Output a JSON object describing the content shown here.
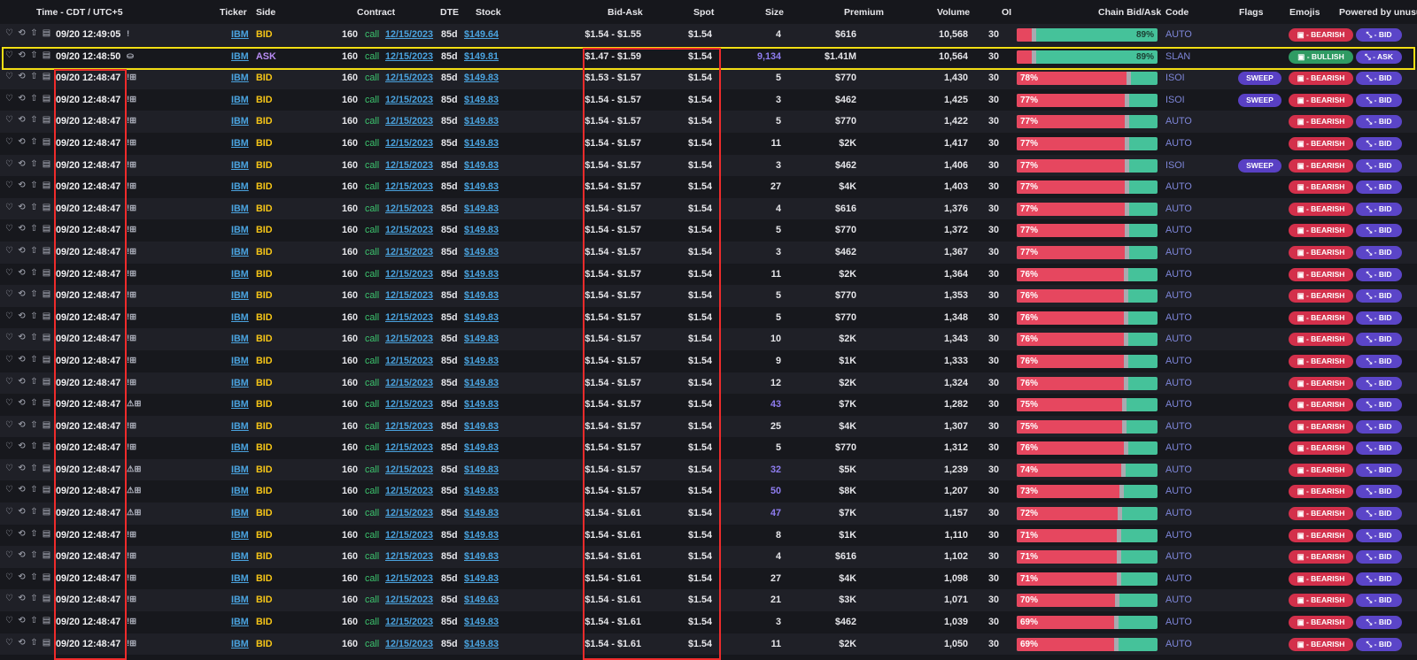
{
  "header": {
    "time": "Time - CDT / UTC+5",
    "ticker": "Ticker",
    "side": "Side",
    "contract": "Contract",
    "dte": "DTE",
    "stock": "Stock",
    "bid_ask": "Bid-Ask",
    "spot": "Spot",
    "size": "Size",
    "premium": "Premium",
    "volume": "Volume",
    "oi": "OI",
    "chain_bid_ask": "Chain Bid/Ask",
    "code": "Code",
    "flags": "Flags",
    "emojis": "Emojis",
    "powered_by": "Powered by unusu"
  },
  "colors": {
    "bid_side": "#f5c518",
    "ask_side": "#b98cf5",
    "link": "#4aa3df",
    "bar_bid": "#e6475f",
    "bar_ask": "#45c29a",
    "highlight_red": "#ef2b2b",
    "highlight_yellow": "#f3de14"
  },
  "rows": [
    {
      "time": "09/20 12:49:05",
      "flag_icon": "!",
      "ticker": "IBM",
      "side": "BID",
      "strike": "160",
      "type": "call",
      "expiry": "12/15/2023",
      "dte": "85d",
      "stock": "$149.64",
      "bid_ask": "$1.54 - $1.55",
      "spot": "$1.54",
      "size": "4",
      "premium": "$616",
      "volume": "10,568",
      "oi": "30",
      "chain_pct": "89%",
      "chain_red": 0.11,
      "code": "AUTO",
      "flag": "",
      "emoji": "- BEARISH",
      "side_pill": "- BID"
    },
    {
      "time": "09/20 12:48:50",
      "flag_icon": "⛀",
      "ticker": "IBM",
      "side": "ASK",
      "strike": "160",
      "type": "call",
      "expiry": "12/15/2023",
      "dte": "85d",
      "stock": "$149.81",
      "bid_ask": "$1.47 - $1.59",
      "spot": "$1.54",
      "size": "9,134",
      "premium": "$1.41M",
      "volume": "10,564",
      "oi": "30",
      "chain_pct": "89%",
      "chain_red": 0.11,
      "code": "SLAN",
      "flag": "",
      "emoji": "- BULLISH",
      "side_pill": "- ASK"
    },
    {
      "time": "09/20 12:48:47",
      "flag_icon": "!⊞",
      "ticker": "IBM",
      "side": "BID",
      "strike": "160",
      "type": "call",
      "expiry": "12/15/2023",
      "dte": "85d",
      "stock": "$149.83",
      "bid_ask": "$1.53 - $1.57",
      "spot": "$1.54",
      "size": "5",
      "premium": "$770",
      "volume": "1,430",
      "oi": "30",
      "chain_pct": "78%",
      "chain_red": 0.78,
      "code": "ISOI",
      "flag": "SWEEP",
      "emoji": "- BEARISH",
      "side_pill": "- BID"
    },
    {
      "time": "09/20 12:48:47",
      "flag_icon": "!⊞",
      "ticker": "IBM",
      "side": "BID",
      "strike": "160",
      "type": "call",
      "expiry": "12/15/2023",
      "dte": "85d",
      "stock": "$149.83",
      "bid_ask": "$1.54 - $1.57",
      "spot": "$1.54",
      "size": "3",
      "premium": "$462",
      "volume": "1,425",
      "oi": "30",
      "chain_pct": "77%",
      "chain_red": 0.77,
      "code": "ISOI",
      "flag": "SWEEP",
      "emoji": "- BEARISH",
      "side_pill": "- BID"
    },
    {
      "time": "09/20 12:48:47",
      "flag_icon": "!⊞",
      "ticker": "IBM",
      "side": "BID",
      "strike": "160",
      "type": "call",
      "expiry": "12/15/2023",
      "dte": "85d",
      "stock": "$149.83",
      "bid_ask": "$1.54 - $1.57",
      "spot": "$1.54",
      "size": "5",
      "premium": "$770",
      "volume": "1,422",
      "oi": "30",
      "chain_pct": "77%",
      "chain_red": 0.77,
      "code": "AUTO",
      "flag": "",
      "emoji": "- BEARISH",
      "side_pill": "- BID"
    },
    {
      "time": "09/20 12:48:47",
      "flag_icon": "!⊞",
      "ticker": "IBM",
      "side": "BID",
      "strike": "160",
      "type": "call",
      "expiry": "12/15/2023",
      "dte": "85d",
      "stock": "$149.83",
      "bid_ask": "$1.54 - $1.57",
      "spot": "$1.54",
      "size": "11",
      "premium": "$2K",
      "volume": "1,417",
      "oi": "30",
      "chain_pct": "77%",
      "chain_red": 0.77,
      "code": "AUTO",
      "flag": "",
      "emoji": "- BEARISH",
      "side_pill": "- BID"
    },
    {
      "time": "09/20 12:48:47",
      "flag_icon": "!⊞",
      "ticker": "IBM",
      "side": "BID",
      "strike": "160",
      "type": "call",
      "expiry": "12/15/2023",
      "dte": "85d",
      "stock": "$149.83",
      "bid_ask": "$1.54 - $1.57",
      "spot": "$1.54",
      "size": "3",
      "premium": "$462",
      "volume": "1,406",
      "oi": "30",
      "chain_pct": "77%",
      "chain_red": 0.77,
      "code": "ISOI",
      "flag": "SWEEP",
      "emoji": "- BEARISH",
      "side_pill": "- BID"
    },
    {
      "time": "09/20 12:48:47",
      "flag_icon": "!⊞",
      "ticker": "IBM",
      "side": "BID",
      "strike": "160",
      "type": "call",
      "expiry": "12/15/2023",
      "dte": "85d",
      "stock": "$149.83",
      "bid_ask": "$1.54 - $1.57",
      "spot": "$1.54",
      "size": "27",
      "premium": "$4K",
      "volume": "1,403",
      "oi": "30",
      "chain_pct": "77%",
      "chain_red": 0.77,
      "code": "AUTO",
      "flag": "",
      "emoji": "- BEARISH",
      "side_pill": "- BID"
    },
    {
      "time": "09/20 12:48:47",
      "flag_icon": "!⊞",
      "ticker": "IBM",
      "side": "BID",
      "strike": "160",
      "type": "call",
      "expiry": "12/15/2023",
      "dte": "85d",
      "stock": "$149.83",
      "bid_ask": "$1.54 - $1.57",
      "spot": "$1.54",
      "size": "4",
      "premium": "$616",
      "volume": "1,376",
      "oi": "30",
      "chain_pct": "77%",
      "chain_red": 0.77,
      "code": "AUTO",
      "flag": "",
      "emoji": "- BEARISH",
      "side_pill": "- BID"
    },
    {
      "time": "09/20 12:48:47",
      "flag_icon": "!⊞",
      "ticker": "IBM",
      "side": "BID",
      "strike": "160",
      "type": "call",
      "expiry": "12/15/2023",
      "dte": "85d",
      "stock": "$149.83",
      "bid_ask": "$1.54 - $1.57",
      "spot": "$1.54",
      "size": "5",
      "premium": "$770",
      "volume": "1,372",
      "oi": "30",
      "chain_pct": "77%",
      "chain_red": 0.77,
      "code": "AUTO",
      "flag": "",
      "emoji": "- BEARISH",
      "side_pill": "- BID"
    },
    {
      "time": "09/20 12:48:47",
      "flag_icon": "!⊞",
      "ticker": "IBM",
      "side": "BID",
      "strike": "160",
      "type": "call",
      "expiry": "12/15/2023",
      "dte": "85d",
      "stock": "$149.83",
      "bid_ask": "$1.54 - $1.57",
      "spot": "$1.54",
      "size": "3",
      "premium": "$462",
      "volume": "1,367",
      "oi": "30",
      "chain_pct": "77%",
      "chain_red": 0.77,
      "code": "AUTO",
      "flag": "",
      "emoji": "- BEARISH",
      "side_pill": "- BID"
    },
    {
      "time": "09/20 12:48:47",
      "flag_icon": "!⊞",
      "ticker": "IBM",
      "side": "BID",
      "strike": "160",
      "type": "call",
      "expiry": "12/15/2023",
      "dte": "85d",
      "stock": "$149.83",
      "bid_ask": "$1.54 - $1.57",
      "spot": "$1.54",
      "size": "11",
      "premium": "$2K",
      "volume": "1,364",
      "oi": "30",
      "chain_pct": "76%",
      "chain_red": 0.76,
      "code": "AUTO",
      "flag": "",
      "emoji": "- BEARISH",
      "side_pill": "- BID"
    },
    {
      "time": "09/20 12:48:47",
      "flag_icon": "!⊞",
      "ticker": "IBM",
      "side": "BID",
      "strike": "160",
      "type": "call",
      "expiry": "12/15/2023",
      "dte": "85d",
      "stock": "$149.83",
      "bid_ask": "$1.54 - $1.57",
      "spot": "$1.54",
      "size": "5",
      "premium": "$770",
      "volume": "1,353",
      "oi": "30",
      "chain_pct": "76%",
      "chain_red": 0.76,
      "code": "AUTO",
      "flag": "",
      "emoji": "- BEARISH",
      "side_pill": "- BID"
    },
    {
      "time": "09/20 12:48:47",
      "flag_icon": "!⊞",
      "ticker": "IBM",
      "side": "BID",
      "strike": "160",
      "type": "call",
      "expiry": "12/15/2023",
      "dte": "85d",
      "stock": "$149.83",
      "bid_ask": "$1.54 - $1.57",
      "spot": "$1.54",
      "size": "5",
      "premium": "$770",
      "volume": "1,348",
      "oi": "30",
      "chain_pct": "76%",
      "chain_red": 0.76,
      "code": "AUTO",
      "flag": "",
      "emoji": "- BEARISH",
      "side_pill": "- BID"
    },
    {
      "time": "09/20 12:48:47",
      "flag_icon": "!⊞",
      "ticker": "IBM",
      "side": "BID",
      "strike": "160",
      "type": "call",
      "expiry": "12/15/2023",
      "dte": "85d",
      "stock": "$149.83",
      "bid_ask": "$1.54 - $1.57",
      "spot": "$1.54",
      "size": "10",
      "premium": "$2K",
      "volume": "1,343",
      "oi": "30",
      "chain_pct": "76%",
      "chain_red": 0.76,
      "code": "AUTO",
      "flag": "",
      "emoji": "- BEARISH",
      "side_pill": "- BID"
    },
    {
      "time": "09/20 12:48:47",
      "flag_icon": "!⊞",
      "ticker": "IBM",
      "side": "BID",
      "strike": "160",
      "type": "call",
      "expiry": "12/15/2023",
      "dte": "85d",
      "stock": "$149.83",
      "bid_ask": "$1.54 - $1.57",
      "spot": "$1.54",
      "size": "9",
      "premium": "$1K",
      "volume": "1,333",
      "oi": "30",
      "chain_pct": "76%",
      "chain_red": 0.76,
      "code": "AUTO",
      "flag": "",
      "emoji": "- BEARISH",
      "side_pill": "- BID"
    },
    {
      "time": "09/20 12:48:47",
      "flag_icon": "!⊞",
      "ticker": "IBM",
      "side": "BID",
      "strike": "160",
      "type": "call",
      "expiry": "12/15/2023",
      "dte": "85d",
      "stock": "$149.83",
      "bid_ask": "$1.54 - $1.57",
      "spot": "$1.54",
      "size": "12",
      "premium": "$2K",
      "volume": "1,324",
      "oi": "30",
      "chain_pct": "76%",
      "chain_red": 0.76,
      "code": "AUTO",
      "flag": "",
      "emoji": "- BEARISH",
      "side_pill": "- BID"
    },
    {
      "time": "09/20 12:48:47",
      "flag_icon": "⚠⊞",
      "ticker": "IBM",
      "side": "BID",
      "strike": "160",
      "type": "call",
      "expiry": "12/15/2023",
      "dte": "85d",
      "stock": "$149.83",
      "bid_ask": "$1.54 - $1.57",
      "spot": "$1.54",
      "size": "43",
      "premium": "$7K",
      "volume": "1,282",
      "oi": "30",
      "chain_pct": "75%",
      "chain_red": 0.75,
      "code": "AUTO",
      "flag": "",
      "emoji": "- BEARISH",
      "side_pill": "- BID"
    },
    {
      "time": "09/20 12:48:47",
      "flag_icon": "!⊞",
      "ticker": "IBM",
      "side": "BID",
      "strike": "160",
      "type": "call",
      "expiry": "12/15/2023",
      "dte": "85d",
      "stock": "$149.83",
      "bid_ask": "$1.54 - $1.57",
      "spot": "$1.54",
      "size": "25",
      "premium": "$4K",
      "volume": "1,307",
      "oi": "30",
      "chain_pct": "75%",
      "chain_red": 0.75,
      "code": "AUTO",
      "flag": "",
      "emoji": "- BEARISH",
      "side_pill": "- BID"
    },
    {
      "time": "09/20 12:48:47",
      "flag_icon": "!⊞",
      "ticker": "IBM",
      "side": "BID",
      "strike": "160",
      "type": "call",
      "expiry": "12/15/2023",
      "dte": "85d",
      "stock": "$149.83",
      "bid_ask": "$1.54 - $1.57",
      "spot": "$1.54",
      "size": "5",
      "premium": "$770",
      "volume": "1,312",
      "oi": "30",
      "chain_pct": "76%",
      "chain_red": 0.76,
      "code": "AUTO",
      "flag": "",
      "emoji": "- BEARISH",
      "side_pill": "- BID"
    },
    {
      "time": "09/20 12:48:47",
      "flag_icon": "⚠⊞",
      "ticker": "IBM",
      "side": "BID",
      "strike": "160",
      "type": "call",
      "expiry": "12/15/2023",
      "dte": "85d",
      "stock": "$149.83",
      "bid_ask": "$1.54 - $1.57",
      "spot": "$1.54",
      "size": "32",
      "premium": "$5K",
      "volume": "1,239",
      "oi": "30",
      "chain_pct": "74%",
      "chain_red": 0.74,
      "code": "AUTO",
      "flag": "",
      "emoji": "- BEARISH",
      "side_pill": "- BID"
    },
    {
      "time": "09/20 12:48:47",
      "flag_icon": "⚠⊞",
      "ticker": "IBM",
      "side": "BID",
      "strike": "160",
      "type": "call",
      "expiry": "12/15/2023",
      "dte": "85d",
      "stock": "$149.83",
      "bid_ask": "$1.54 - $1.57",
      "spot": "$1.54",
      "size": "50",
      "premium": "$8K",
      "volume": "1,207",
      "oi": "30",
      "chain_pct": "73%",
      "chain_red": 0.73,
      "code": "AUTO",
      "flag": "",
      "emoji": "- BEARISH",
      "side_pill": "- BID"
    },
    {
      "time": "09/20 12:48:47",
      "flag_icon": "⚠⊞",
      "ticker": "IBM",
      "side": "BID",
      "strike": "160",
      "type": "call",
      "expiry": "12/15/2023",
      "dte": "85d",
      "stock": "$149.83",
      "bid_ask": "$1.54 - $1.61",
      "spot": "$1.54",
      "size": "47",
      "premium": "$7K",
      "volume": "1,157",
      "oi": "30",
      "chain_pct": "72%",
      "chain_red": 0.72,
      "code": "AUTO",
      "flag": "",
      "emoji": "- BEARISH",
      "side_pill": "- BID"
    },
    {
      "time": "09/20 12:48:47",
      "flag_icon": "!⊞",
      "ticker": "IBM",
      "side": "BID",
      "strike": "160",
      "type": "call",
      "expiry": "12/15/2023",
      "dte": "85d",
      "stock": "$149.83",
      "bid_ask": "$1.54 - $1.61",
      "spot": "$1.54",
      "size": "8",
      "premium": "$1K",
      "volume": "1,110",
      "oi": "30",
      "chain_pct": "71%",
      "chain_red": 0.71,
      "code": "AUTO",
      "flag": "",
      "emoji": "- BEARISH",
      "side_pill": "- BID"
    },
    {
      "time": "09/20 12:48:47",
      "flag_icon": "!⊞",
      "ticker": "IBM",
      "side": "BID",
      "strike": "160",
      "type": "call",
      "expiry": "12/15/2023",
      "dte": "85d",
      "stock": "$149.83",
      "bid_ask": "$1.54 - $1.61",
      "spot": "$1.54",
      "size": "4",
      "premium": "$616",
      "volume": "1,102",
      "oi": "30",
      "chain_pct": "71%",
      "chain_red": 0.71,
      "code": "AUTO",
      "flag": "",
      "emoji": "- BEARISH",
      "side_pill": "- BID"
    },
    {
      "time": "09/20 12:48:47",
      "flag_icon": "!⊞",
      "ticker": "IBM",
      "side": "BID",
      "strike": "160",
      "type": "call",
      "expiry": "12/15/2023",
      "dte": "85d",
      "stock": "$149.83",
      "bid_ask": "$1.54 - $1.61",
      "spot": "$1.54",
      "size": "27",
      "premium": "$4K",
      "volume": "1,098",
      "oi": "30",
      "chain_pct": "71%",
      "chain_red": 0.71,
      "code": "AUTO",
      "flag": "",
      "emoji": "- BEARISH",
      "side_pill": "- BID"
    },
    {
      "time": "09/20 12:48:47",
      "flag_icon": "!⊞",
      "ticker": "IBM",
      "side": "BID",
      "strike": "160",
      "type": "call",
      "expiry": "12/15/2023",
      "dte": "85d",
      "stock": "$149.63",
      "bid_ask": "$1.54 - $1.61",
      "spot": "$1.54",
      "size": "21",
      "premium": "$3K",
      "volume": "1,071",
      "oi": "30",
      "chain_pct": "70%",
      "chain_red": 0.7,
      "code": "AUTO",
      "flag": "",
      "emoji": "- BEARISH",
      "side_pill": "- BID"
    },
    {
      "time": "09/20 12:48:47",
      "flag_icon": "!⊞",
      "ticker": "IBM",
      "side": "BID",
      "strike": "160",
      "type": "call",
      "expiry": "12/15/2023",
      "dte": "85d",
      "stock": "$149.83",
      "bid_ask": "$1.54 - $1.61",
      "spot": "$1.54",
      "size": "3",
      "premium": "$462",
      "volume": "1,039",
      "oi": "30",
      "chain_pct": "69%",
      "chain_red": 0.69,
      "code": "AUTO",
      "flag": "",
      "emoji": "- BEARISH",
      "side_pill": "- BID"
    },
    {
      "time": "09/20 12:48:47",
      "flag_icon": "!⊞",
      "ticker": "IBM",
      "side": "BID",
      "strike": "160",
      "type": "call",
      "expiry": "12/15/2023",
      "dte": "85d",
      "stock": "$149.83",
      "bid_ask": "$1.54 - $1.61",
      "spot": "$1.54",
      "size": "11",
      "premium": "$2K",
      "volume": "1,050",
      "oi": "30",
      "chain_pct": "69%",
      "chain_red": 0.69,
      "code": "AUTO",
      "flag": "",
      "emoji": "- BEARISH",
      "side_pill": "- BID"
    }
  ]
}
